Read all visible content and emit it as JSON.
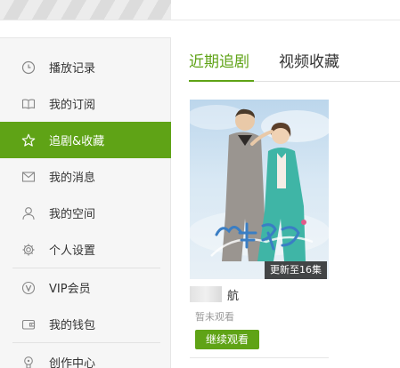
{
  "sidebar": {
    "items": [
      {
        "label": "播放记录",
        "icon": "clock-icon"
      },
      {
        "label": "我的订阅",
        "icon": "book-icon"
      },
      {
        "label": "追剧&收藏",
        "icon": "star-icon",
        "active": true
      },
      {
        "label": "我的消息",
        "icon": "mail-icon"
      },
      {
        "label": "我的空间",
        "icon": "person-icon"
      },
      {
        "label": "个人设置",
        "icon": "gear-icon"
      },
      {
        "label": "VIP会员",
        "icon": "vip-icon"
      },
      {
        "label": "我的钱包",
        "icon": "wallet-icon"
      },
      {
        "label": "创作中心",
        "icon": "creator-icon"
      }
    ]
  },
  "tabs": [
    {
      "label": "近期追剧",
      "active": true
    },
    {
      "label": "视频收藏"
    }
  ],
  "card": {
    "badge": "更新至16集",
    "title_suffix": "航",
    "status": "暂未观看",
    "button": "继续观看",
    "poster_logo_icon": "drama-title-logo"
  },
  "colors": {
    "accent": "#5fa316",
    "sidebar_bg": "#f6f6f6"
  }
}
